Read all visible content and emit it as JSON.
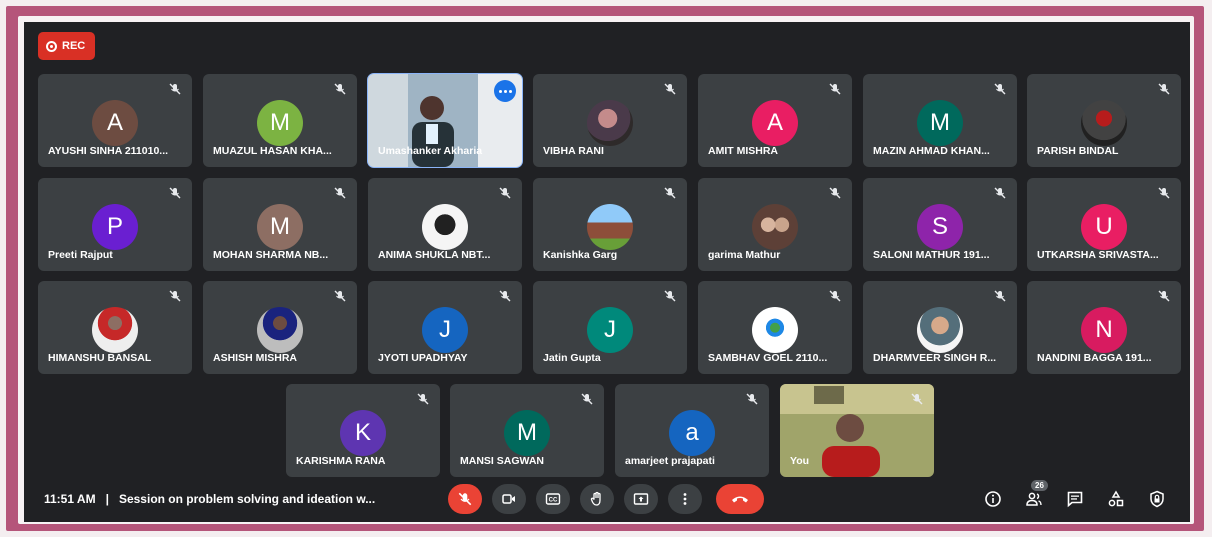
{
  "recording": {
    "label": "REC"
  },
  "tiles": [
    {
      "name": "AYUSHI SINHA 211010...",
      "initial": "A",
      "color": "#6d4c41"
    },
    {
      "name": "MUAZUL HASAN KHA...",
      "initial": "M",
      "color": "#7cb342"
    },
    {
      "name": "Umashanker Akharia",
      "initial": "",
      "color": "#8ab4f8"
    },
    {
      "name": "VIBHA RANI",
      "initial": "",
      "color": "#5f6368"
    },
    {
      "name": "AMIT MISHRA",
      "initial": "A",
      "color": "#e91e63"
    },
    {
      "name": "MAZIN AHMAD KHAN...",
      "initial": "M",
      "color": "#00695c"
    },
    {
      "name": "PARISH BINDAL",
      "initial": "",
      "color": "#5f6368"
    },
    {
      "name": "Preeti Rajput",
      "initial": "P",
      "color": "#6a1fd1"
    },
    {
      "name": "MOHAN SHARMA NB...",
      "initial": "M",
      "color": "#8d6e63"
    },
    {
      "name": "ANIMA SHUKLA NBT...",
      "initial": "",
      "color": "#5f6368"
    },
    {
      "name": "Kanishka Garg",
      "initial": "",
      "color": "#5f6368"
    },
    {
      "name": "garima Mathur",
      "initial": "",
      "color": "#5f6368"
    },
    {
      "name": "SALONI MATHUR 191...",
      "initial": "S",
      "color": "#8e24aa"
    },
    {
      "name": "UTKARSHA SRIVASTA...",
      "initial": "U",
      "color": "#e91e63"
    },
    {
      "name": "HIMANSHU BANSAL",
      "initial": "",
      "color": "#5f6368"
    },
    {
      "name": "ASHISH MISHRA",
      "initial": "",
      "color": "#5f6368"
    },
    {
      "name": "JYOTI UPADHYAY",
      "initial": "J",
      "color": "#1565c0"
    },
    {
      "name": "Jatin Gupta",
      "initial": "J",
      "color": "#00897b"
    },
    {
      "name": "SAMBHAV GOEL 2110...",
      "initial": "",
      "color": "#5f6368"
    },
    {
      "name": "DHARMVEER SINGH R...",
      "initial": "",
      "color": "#5f6368"
    },
    {
      "name": "NANDINI BAGGA 191...",
      "initial": "N",
      "color": "#d81b60"
    },
    {
      "name": "KARISHMA RANA",
      "initial": "K",
      "color": "#5e35b1"
    },
    {
      "name": "MANSI SAGWAN",
      "initial": "M",
      "color": "#00695c"
    },
    {
      "name": "amarjeet prajapati",
      "initial": "a",
      "color": "#1565c0"
    },
    {
      "name": "You",
      "initial": "",
      "color": "#5f6368"
    }
  ],
  "bottom_bar": {
    "time": "11:51 AM",
    "separator": "|",
    "meeting_title": "Session on problem solving and ideation w...",
    "participant_count": "26"
  }
}
